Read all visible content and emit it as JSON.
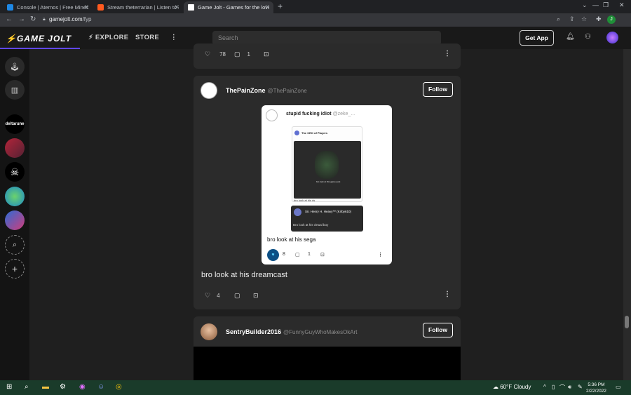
{
  "browser": {
    "tabs": [
      {
        "title": "Console | Aternos | Free Minecraft",
        "active": false
      },
      {
        "title": "Stream theterrarian | Listen to e",
        "active": false
      },
      {
        "title": "Game Jolt - Games for the love o",
        "active": true
      }
    ],
    "new_tab": "+",
    "url_domain": "gamejolt.com",
    "url_path": "/fyp",
    "profile_initial": "J"
  },
  "site": {
    "logo": "GAME JOLT",
    "nav": [
      "EXPLORE",
      "STORE"
    ],
    "search_placeholder": "Search",
    "get_app": "Get App"
  },
  "feed": {
    "top_card": {
      "likes": "78",
      "comments": "1"
    },
    "post1": {
      "username": "ThePainZone",
      "handle": "@ThePainZone",
      "follow_label": "Follow",
      "caption": "bro look at his dreamcast",
      "likes": "4",
      "embed": {
        "username": "stupid fucking idiot",
        "handle": "@zeke_...",
        "nested_title": "The CEO of Players",
        "nested_small": "bro look at this game post",
        "nested_caption": "bro look at his ds",
        "nested_user": "Sir. Henry H. Heavy™ (Kirby610)",
        "nested_text": "Bro look at his virtual boy",
        "caption": "bro look at his sega",
        "likes": "8",
        "comments": "1"
      }
    },
    "post2": {
      "username": "SentryBuilder2016",
      "handle": "@FunnyGuyWhoMakesOkArt",
      "follow_label": "Follow"
    }
  },
  "sidebar": {
    "community_label": "deltarune"
  },
  "taskbar": {
    "weather": "60°F  Cloudy",
    "time": "5:36 PM",
    "date": "2/22/2022"
  },
  "colors": {
    "accent": "#6047ff",
    "background": "#1f1f1f",
    "card": "#2b2b2b",
    "like_active": "#0b4f85"
  }
}
